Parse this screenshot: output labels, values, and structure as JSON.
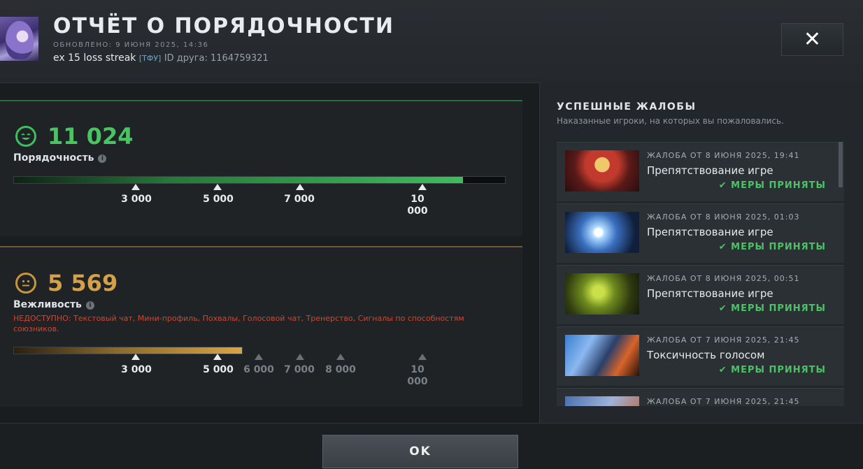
{
  "header": {
    "title": "ОТЧЁТ О ПОРЯДОЧНОСТИ",
    "updated": "ОБНОВЛЕНО: 9 ИЮНЯ 2025, 14:36",
    "username": "ex 15 loss streak",
    "clan_tag": "[ТФУ]",
    "friend_id": "ID друга: 1164759321",
    "close_glyph": "✕"
  },
  "behavior": {
    "score": "11 024",
    "label": "Порядочность",
    "info_glyph": "i",
    "fill_fraction": 0.915,
    "ticks": [
      "3 000",
      "5 000",
      "7 000",
      "10 000"
    ]
  },
  "communication": {
    "score": "5 569",
    "label": "Вежливость",
    "info_glyph": "i",
    "fill_fraction": 0.463,
    "unavailable": "НЕДОСТУПНО: Текстовый чат, Мини-профиль, Похвалы, Голосовой чат, Тренерство, Сигналы по способностям союзников.",
    "ticks": [
      "3 000",
      "5 000",
      "6 000",
      "7 000",
      "8 000",
      "10 000"
    ]
  },
  "reports": {
    "title": "УСПЕШНЫЕ ЖАЛОБЫ",
    "subtitle": "Наказанные игроки, на которых вы пожаловались.",
    "items": [
      {
        "date": "ЖАЛОБА ОТ 8 ИЮНЯ 2025, 19:41",
        "reason": "Препятствование игре",
        "status": "МЕРЫ ПРИНЯТЫ"
      },
      {
        "date": "ЖАЛОБА ОТ 8 ИЮНЯ 2025, 01:03",
        "reason": "Препятствование игре",
        "status": "МЕРЫ ПРИНЯТЫ"
      },
      {
        "date": "ЖАЛОБА ОТ 8 ИЮНЯ 2025, 00:51",
        "reason": "Препятствование игре",
        "status": "МЕРЫ ПРИНЯТЫ"
      },
      {
        "date": "ЖАЛОБА ОТ 7 ИЮНЯ 2025, 21:45",
        "reason": "Токсичность голосом",
        "status": "МЕРЫ ПРИНЯТЫ"
      },
      {
        "date": "ЖАЛОБА ОТ 7 ИЮНЯ 2025, 21:45"
      }
    ]
  },
  "footer": {
    "ok_label": "OK"
  },
  "colors": {
    "green": "#4ac462",
    "gold": "#d4a048",
    "status_green": "#4cc166",
    "warning_red": "#d3452f"
  },
  "icons": {
    "behavior_face": "smile-face-icon",
    "communication_face": "neutral-face-icon",
    "check": "check-icon",
    "info": "info-icon",
    "close": "close-icon"
  }
}
